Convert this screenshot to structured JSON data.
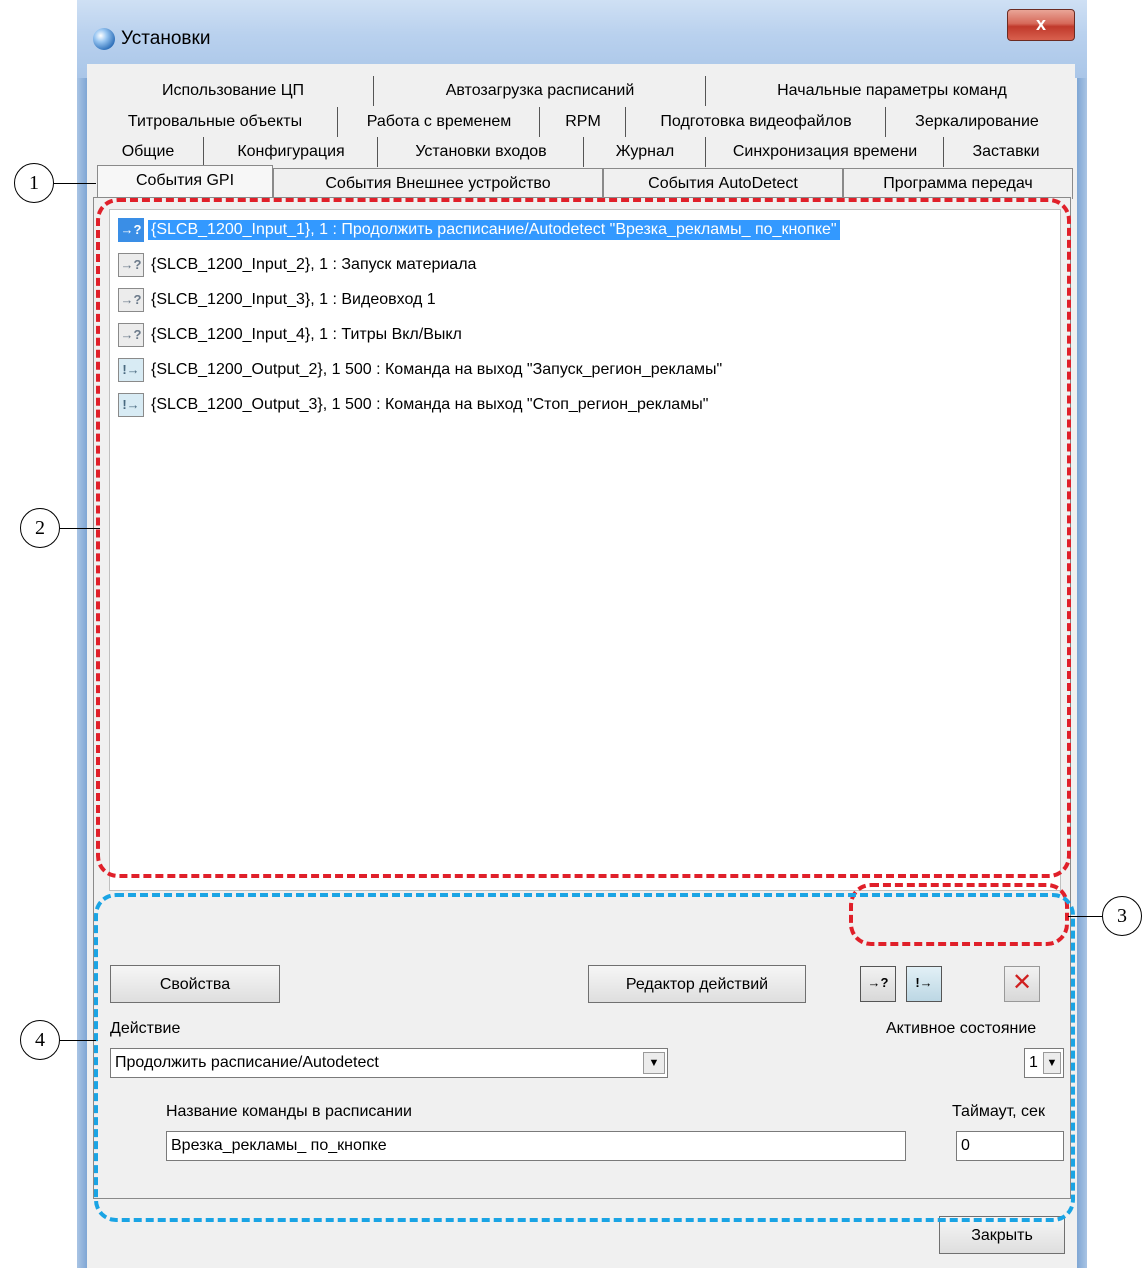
{
  "window": {
    "title": "Установки",
    "close_glyph": "x"
  },
  "tabs": {
    "row1": [
      "Использование ЦП",
      "Автозагрузка расписаний",
      "Начальные параметры команд"
    ],
    "row2": [
      "Титровальные объекты",
      "Работа с временем",
      "RPM",
      "Подготовка видеофайлов",
      "Зеркалирование"
    ],
    "row3": [
      "Общие",
      "Конфигурация",
      "Установки входов",
      "Журнал",
      "Синхронизация времени",
      "Заставки"
    ],
    "row4": [
      "События GPI",
      "События Внешнее устройство",
      "События AutoDetect",
      "Программа передач"
    ],
    "active": "События GPI"
  },
  "events": [
    {
      "icon": "input-event-icon",
      "glyph": "→?",
      "text": "{SLCB_1200_Input_1}, 1 : Продолжить расписание/Autodetect \"Врезка_рекламы_ по_кнопке\""
    },
    {
      "icon": "input-event-icon",
      "glyph": "→?",
      "text": "{SLCB_1200_Input_2}, 1 : Запуск материала"
    },
    {
      "icon": "input-event-icon",
      "glyph": "→?",
      "text": "{SLCB_1200_Input_3}, 1 : Видеовход 1"
    },
    {
      "icon": "input-event-icon",
      "glyph": "→?",
      "text": "{SLCB_1200_Input_4}, 1 : Титры Вкл/Выкл"
    },
    {
      "icon": "output-command-icon",
      "glyph": "!→",
      "text": "{SLCB_1200_Output_2}, 1 500 : Команда на выход \"Запуск_регион_рекламы\""
    },
    {
      "icon": "output-command-icon",
      "glyph": "!→",
      "text": "{SLCB_1200_Output_3}, 1 500 : Команда на выход \"Стоп_регион_рекламы\""
    }
  ],
  "buttons": {
    "properties": "Свойства",
    "action_editor": "Редактор действий",
    "close": "Закрыть"
  },
  "form": {
    "action_label": "Действие",
    "action_value": "Продолжить расписание/Autodetect",
    "active_state_label": "Активное состояние",
    "active_state_value": "1",
    "command_name_label": "Название команды в расписании",
    "command_name_value": "Врезка_рекламы_ по_кнопке",
    "timeout_label": "Таймаут, сек",
    "timeout_value": "0"
  },
  "callouts": [
    "1",
    "2",
    "3",
    "4"
  ],
  "colors": {
    "selection": "#3399ff",
    "highlight_red": "#e0202a",
    "highlight_blue": "#1aa4e4",
    "delete_x": "#d02020"
  }
}
